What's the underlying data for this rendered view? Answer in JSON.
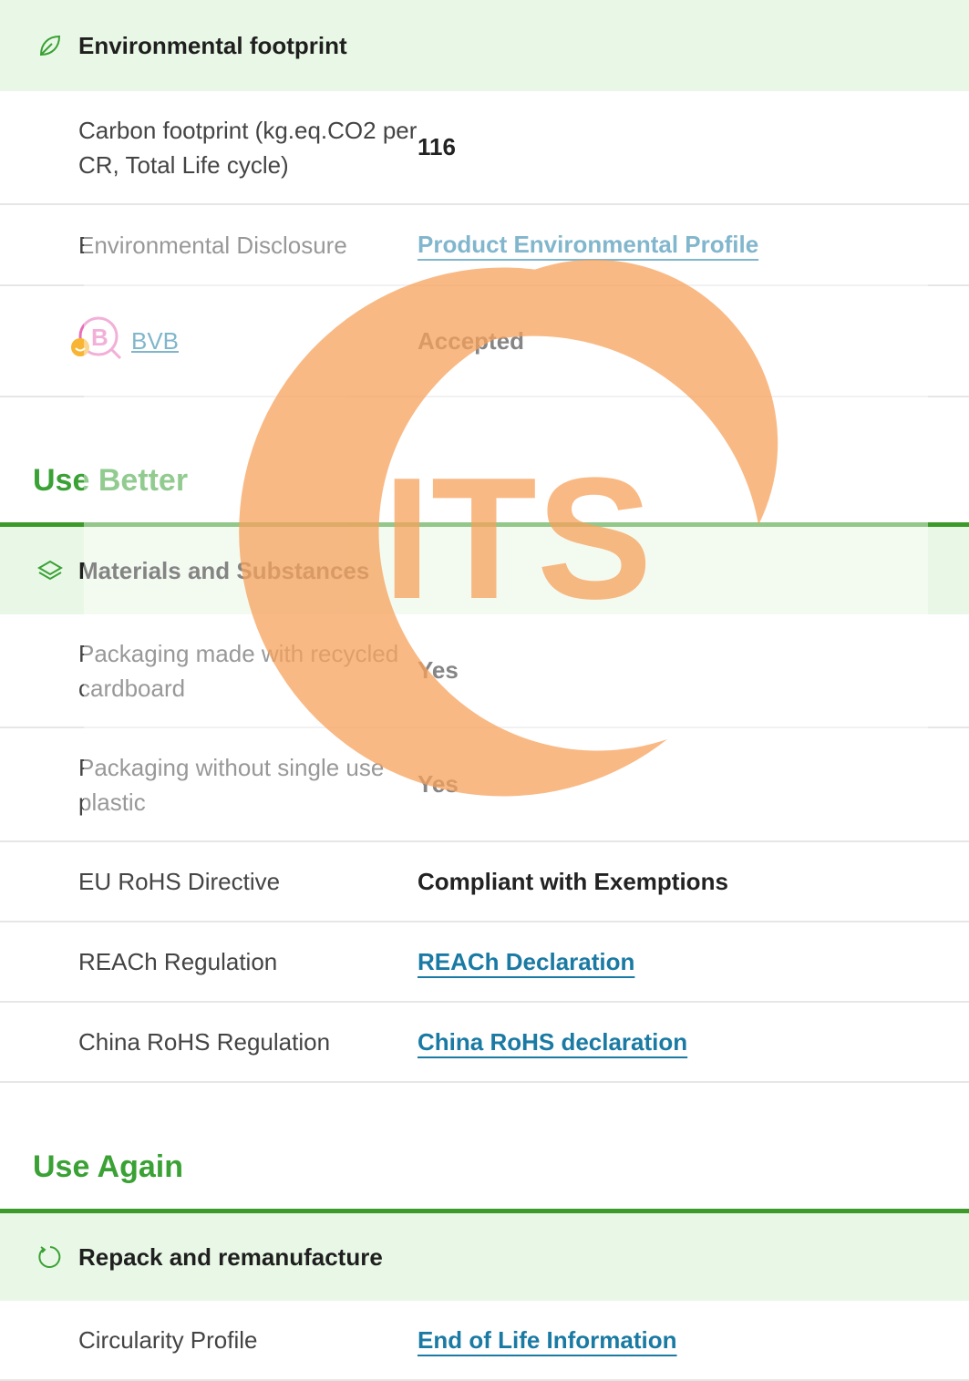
{
  "env_footprint": {
    "header": "Environmental footprint",
    "icon": "leaf-icon",
    "rows": [
      {
        "label": "Carbon footprint (kg.eq.CO2 per CR, Total Life cycle)",
        "value": "116"
      },
      {
        "label": "Environmental Disclosure",
        "value": "Product Environmental Profile"
      },
      {
        "label": "BVB",
        "value": "Accepted"
      }
    ]
  },
  "use_better": {
    "title": "Use Better",
    "subheader": "Materials and Substances",
    "icon": "layers-icon",
    "rows": [
      {
        "label": "Packaging made with recycled cardboard",
        "value": "Yes"
      },
      {
        "label": "Packaging without single use plastic",
        "value": "Yes"
      },
      {
        "label": "EU RoHS Directive",
        "value": "Compliant with Exemptions"
      },
      {
        "label": "REACh Regulation",
        "value": "REACh Declaration"
      },
      {
        "label": "China RoHS Regulation",
        "value": "China RoHS declaration"
      }
    ]
  },
  "use_again": {
    "title": "Use Again",
    "subheader": "Repack and remanufacture",
    "icon": "refresh-icon",
    "rows": [
      {
        "label": "Circularity Profile",
        "value": "End of Life Information"
      }
    ]
  },
  "watermark": {
    "text": "ITS",
    "color": "#f7a25c"
  },
  "colors": {
    "accent_green": "#3aa135",
    "header_bg": "#e9f8e6",
    "link": "#1a7aa3"
  }
}
